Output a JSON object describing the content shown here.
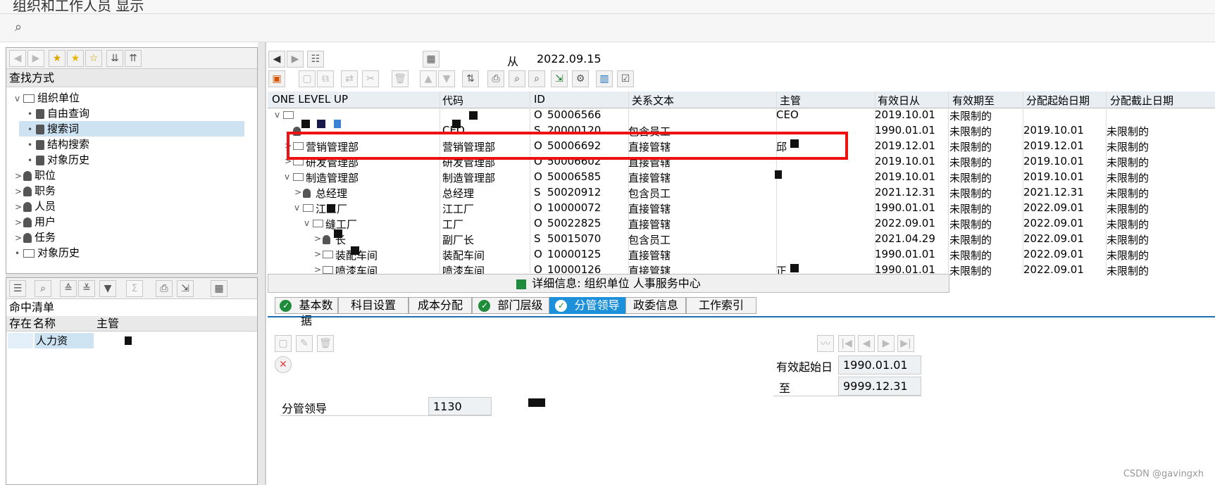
{
  "window": {
    "title": "组织和工作人员 显示"
  },
  "left_panel": {
    "find_by_label": "查找方式",
    "tree": [
      {
        "label": "组织单位",
        "level": 0,
        "toggle": "v",
        "icon": "org-unit-icon"
      },
      {
        "label": "自由查询",
        "level": 1,
        "toggle": "•",
        "icon": "binoculars-icon"
      },
      {
        "label": "搜索词",
        "level": 1,
        "toggle": "•",
        "icon": "binoculars-icon",
        "selected": true
      },
      {
        "label": "结构搜索",
        "level": 1,
        "toggle": "•",
        "icon": "binoculars-icon"
      },
      {
        "label": "对象历史",
        "level": 1,
        "toggle": "•",
        "icon": "binoculars-icon"
      },
      {
        "label": "职位",
        "level": 0,
        "toggle": ">",
        "icon": "position-icon"
      },
      {
        "label": "职务",
        "level": 0,
        "toggle": ">",
        "icon": "job-icon"
      },
      {
        "label": "人员",
        "level": 0,
        "toggle": ">",
        "icon": "persons-icon"
      },
      {
        "label": "用户",
        "level": 0,
        "toggle": ">",
        "icon": "user-icon"
      },
      {
        "label": "任务",
        "level": 0,
        "toggle": ">",
        "icon": "task-icon"
      },
      {
        "label": "对象历史",
        "level": 0,
        "toggle": "•",
        "icon": "history-icon"
      }
    ],
    "hit_list_label": "命中清单",
    "hit_columns": [
      "存在",
      "名称",
      "主管"
    ],
    "hit_rows": [
      {
        "exists": "",
        "name": "人力资",
        "manager": ""
      }
    ]
  },
  "right_panel": {
    "from_label": "从",
    "date": "2022.09.15",
    "columns": [
      "ONE LEVEL UP",
      "代码",
      "ID",
      "关系文本",
      "主管",
      "有效日从",
      "有效期至",
      "分配起始日期",
      "分配截止日期"
    ],
    "rows": [
      {
        "tree": "v",
        "name": "",
        "code": "",
        "type": "O",
        "id": "50006566",
        "rel": "",
        "mgr": "CEO",
        "valid_from": "2019.10.01",
        "valid_to": "未限制的",
        "assign_from": "",
        "assign_to": ""
      },
      {
        "tree": "",
        "name": "",
        "code": "CEO",
        "type": "S",
        "id": "20000120",
        "rel": "包含员工",
        "mgr": "",
        "valid_from": "1990.01.01",
        "valid_to": "未限制的",
        "assign_from": "2019.10.01",
        "assign_to": "未限制的"
      },
      {
        "tree": ">",
        "name": "营销管理部",
        "code": "营销管理部",
        "type": "O",
        "id": "50006692",
        "rel": "直接管辖",
        "mgr": "邱",
        "valid_from": "2019.12.01",
        "valid_to": "未限制的",
        "assign_from": "2019.12.01",
        "assign_to": "未限制的"
      },
      {
        "tree": ">",
        "name": "研发管理部",
        "code": "研发管理部",
        "type": "O",
        "id": "50006602",
        "rel": "直接管辖",
        "mgr": "",
        "valid_from": "2019.10.01",
        "valid_to": "未限制的",
        "assign_from": "2019.10.01",
        "assign_to": "未限制的"
      },
      {
        "tree": "v",
        "name": "制造管理部",
        "code": "制造管理部",
        "type": "O",
        "id": "50006585",
        "rel": "直接管辖",
        "mgr": "",
        "valid_from": "2019.10.01",
        "valid_to": "未限制的",
        "assign_from": "2019.10.01",
        "assign_to": "未限制的"
      },
      {
        "tree": ">",
        "name": "总经理",
        "code": "总经理",
        "type": "S",
        "id": "50020912",
        "rel": "包含员工",
        "mgr": "",
        "valid_from": "2021.12.31",
        "valid_to": "未限制的",
        "assign_from": "2021.12.31",
        "assign_to": "未限制的"
      },
      {
        "tree": "v",
        "name": "江工厂",
        "code": "江工厂",
        "type": "O",
        "id": "10000072",
        "rel": "直接管辖",
        "mgr": "",
        "valid_from": "1990.01.01",
        "valid_to": "未限制的",
        "assign_from": "2022.09.01",
        "assign_to": "未限制的"
      },
      {
        "tree": "v",
        "name": "缝工厂",
        "code": "工厂",
        "type": "O",
        "id": "50022825",
        "rel": "直接管辖",
        "mgr": "",
        "valid_from": "2022.09.01",
        "valid_to": "未限制的",
        "assign_from": "2022.09.01",
        "assign_to": "未限制的"
      },
      {
        "tree": ">",
        "name": "长",
        "code": "副厂长",
        "type": "S",
        "id": "50015070",
        "rel": "包含员工",
        "mgr": "",
        "valid_from": "2021.04.29",
        "valid_to": "未限制的",
        "assign_from": "2022.09.01",
        "assign_to": "未限制的"
      },
      {
        "tree": ">",
        "name": "装配车间",
        "code": "装配车间",
        "type": "O",
        "id": "10000125",
        "rel": "直接管辖",
        "mgr": "",
        "valid_from": "1990.01.01",
        "valid_to": "未限制的",
        "assign_from": "2022.09.01",
        "assign_to": "未限制的"
      },
      {
        "tree": ">",
        "name": "喷漆车间",
        "code": "喷漆车间",
        "type": "O",
        "id": "10000126",
        "rel": "直接管辖",
        "mgr": "正",
        "valid_from": "1990.01.01",
        "valid_to": "未限制的",
        "assign_from": "2022.09.01",
        "assign_to": "未限制的"
      }
    ],
    "detail_title": "详细信息:  组织单位 人事服务中心",
    "tabs": [
      {
        "label": "基本数据",
        "checked": true
      },
      {
        "label": "科目设置",
        "checked": false
      },
      {
        "label": "成本分配",
        "checked": false
      },
      {
        "label": "部门层级",
        "checked": true
      },
      {
        "label": "分管领导",
        "checked": true,
        "active": true
      },
      {
        "label": "政委信息",
        "checked": false
      },
      {
        "label": "工作索引",
        "checked": false
      }
    ],
    "detail": {
      "valid_from_label": "有效起始日",
      "valid_from": "1990.01.01",
      "to_label": "至",
      "valid_to": "9999.12.31",
      "leader_label": "分管领导",
      "leader_value": "1130"
    }
  },
  "watermark": "CSDN @gavingxh",
  "colors": {
    "highlight_red": "#ee1111",
    "active_tab": "#1c90d8",
    "selection": "#cde3f2"
  }
}
